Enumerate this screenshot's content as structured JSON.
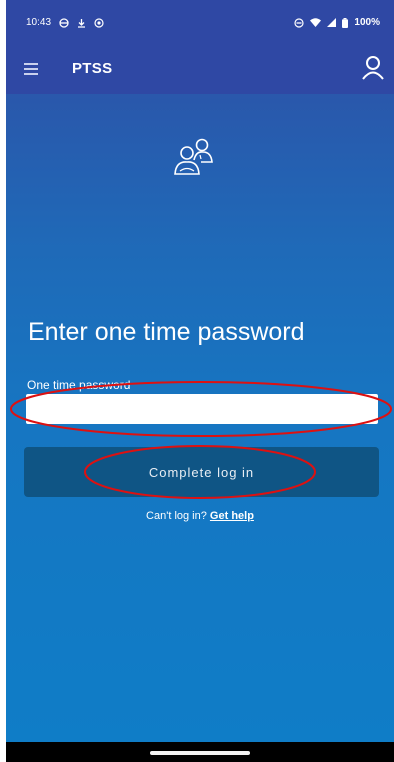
{
  "status_bar": {
    "time": "10:43",
    "battery": "100%"
  },
  "app_bar": {
    "title": "PTSS"
  },
  "main": {
    "heading": "Enter one time password",
    "otp_label": "One time password",
    "otp_value": "",
    "complete_button": "Complete log in",
    "help_prefix": "Can't log in?",
    "help_link": "Get help"
  },
  "colors": {
    "header": "#2f48a4",
    "background_bottom": "#0f7dc7",
    "button": "#0f5585",
    "annotation": "#dd1111"
  }
}
